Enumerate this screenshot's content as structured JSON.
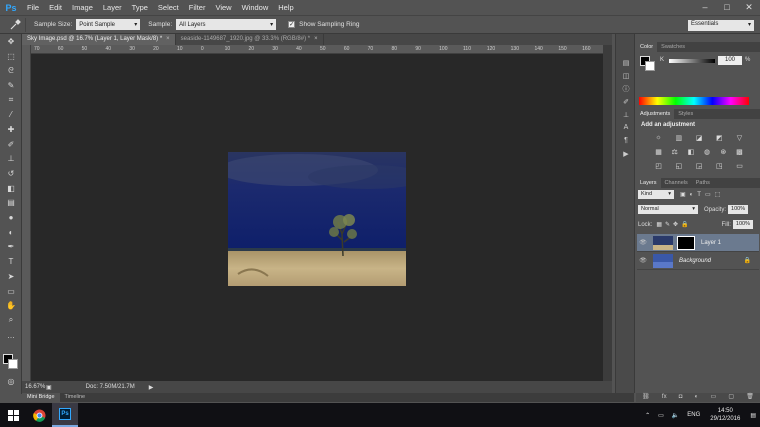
{
  "app": {
    "logo": "Ps"
  },
  "menu": [
    "File",
    "Edit",
    "Image",
    "Layer",
    "Type",
    "Select",
    "Filter",
    "View",
    "Window",
    "Help"
  ],
  "window_controls": {
    "minimize": "–",
    "maximize": "□",
    "close": "✕"
  },
  "options": {
    "sample_size_label": "Sample Size:",
    "sample_size_value": "Point Sample",
    "sample_label": "Sample:",
    "sample_value": "All Layers",
    "show_ring_label": "Show Sampling Ring",
    "show_ring_checked": "✓",
    "workspace": "Essentials"
  },
  "tabs": [
    {
      "label": "Sky Image.psd @ 16.7% (Layer 1, Layer Mask/8) *",
      "close": "×"
    },
    {
      "label": "seaside-1149687_1920.jpg @ 33.3% (RGB/8#) *",
      "close": "×"
    }
  ],
  "ruler_numbers": [
    "70",
    "60",
    "50",
    "40",
    "30",
    "20",
    "10",
    "0",
    "10",
    "20",
    "30",
    "40",
    "50",
    "60",
    "70",
    "80",
    "90",
    "100",
    "110",
    "120",
    "130",
    "140",
    "150",
    "160"
  ],
  "status": {
    "zoom": "16.67%",
    "doc": "Doc: 7.50M/21.7M",
    "arrow": "▶"
  },
  "bottom_tabs": [
    "Mini Bridge",
    "Timeline"
  ],
  "color_panel": {
    "tabs": [
      "Color",
      "Swatches"
    ],
    "k_label": "K",
    "k_value": "100",
    "percent": "%"
  },
  "adjustments_panel": {
    "tabs": [
      "Adjustments",
      "Styles"
    ],
    "title": "Add an adjustment"
  },
  "layers_panel": {
    "tabs": [
      "Layers",
      "Channels",
      "Paths"
    ],
    "kind": "Kind",
    "blend_mode": "Normal",
    "opacity_label": "Opacity:",
    "opacity_value": "100%",
    "lock_label": "Lock:",
    "fill_label": "Fill:",
    "fill_value": "100%",
    "layers": [
      {
        "name": "Layer 1"
      },
      {
        "name": "Background"
      }
    ]
  },
  "taskbar": {
    "language": "ENG",
    "time": "14:50",
    "date": "29/12/2016"
  },
  "colors": {
    "ps_blue": "#31a8ff",
    "canvas_bg": "#282828",
    "panel_bg": "#535353"
  }
}
